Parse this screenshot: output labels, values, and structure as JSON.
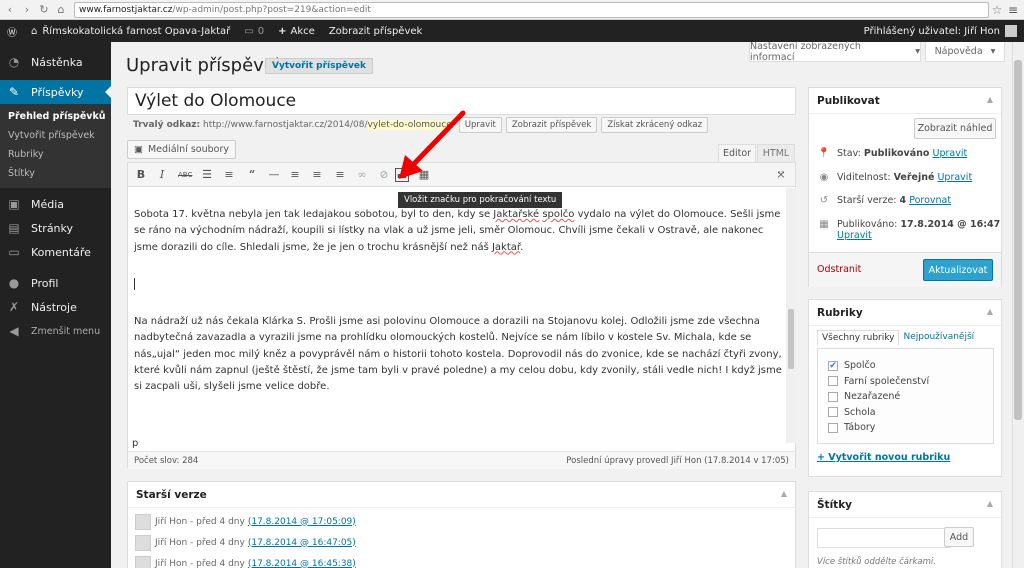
{
  "browser": {
    "url_host": "www.farnostjaktar.cz",
    "url_path": "/wp-admin/post.php?post=219&action=edit"
  },
  "adminbar": {
    "site_name": "Římskokatolická farnost Opava-Jaktař",
    "comments_count": "0",
    "new_label": "Akce",
    "view_post": "Zobrazit příspěvek",
    "user_greeting": "Přihlášený uživatel: Jiří Hon"
  },
  "sidebar": {
    "items": [
      {
        "label": "Nástěnka",
        "icon": "dashboard-icon"
      },
      {
        "label": "Příspěvky",
        "icon": "pin-icon"
      },
      {
        "label": "Média",
        "icon": "media-icon"
      },
      {
        "label": "Stránky",
        "icon": "pages-icon"
      },
      {
        "label": "Komentáře",
        "icon": "comments-icon"
      },
      {
        "label": "Profil",
        "icon": "user-icon"
      },
      {
        "label": "Nástroje",
        "icon": "wrench-icon"
      },
      {
        "label": "Zmenšit menu",
        "icon": "collapse-icon"
      }
    ],
    "submenu": [
      "Přehled příspěvků",
      "Vytvořit příspěvek",
      "Rubriky",
      "Štítky"
    ]
  },
  "header": {
    "screen_options": "Nastavení zobrazených informací",
    "help": "Nápověda",
    "title": "Upravit příspěvek",
    "add_new": "Vytvořit příspěvek"
  },
  "post": {
    "title": "Výlet do Olomouce",
    "permalink_label": "Trvalý odkaz:",
    "permalink_base": "http://www.farnostjaktar.cz/2014/08/",
    "permalink_slug": "vylet-do-olomouce",
    "permalink_tail": "/",
    "btn_edit": "Upravit",
    "btn_view": "Zobrazit příspěvek",
    "btn_shortlink": "Získat zkrácený odkaz"
  },
  "editor": {
    "media_button": "Mediální soubory",
    "tab_visual": "Editor",
    "tab_html": "HTML",
    "tooltip": "Vložit značku pro pokračování textu",
    "path": "p",
    "word_count": "Počet slov: 284",
    "last_edit": "Poslední úpravy provedl Jiří Hon (17.8.2014 v 17:05)",
    "para1": [
      {
        "text": "Sobota 17. května nebyla jen tak ledajakou sobotou, byl to den, kdy se "
      },
      {
        "text": "Jaktařské",
        "spell": true
      },
      {
        "text": " "
      },
      {
        "text": "spolčo",
        "spell": true
      },
      {
        "text": " vydalo na výlet do Olomouce. Sešli jsme se ráno na východním nádraží, koupili si lístky na vlak a už jsme jeli, směr Olomouc. Chvíli jsme čekali v Ostravě, ale nakonec jsme dorazili do cíle. Shledali jsme, že je jen o trochu krásnější než náš "
      },
      {
        "text": "Jaktař",
        "spell": true
      },
      {
        "text": "."
      }
    ],
    "para2": "Na nádraží už nás čekala Klárka S. Prošli jsme asi polovinu Olomouce a dorazili na Stojanovu kolej. Odložili jsme zde všechna nadbytečná zavazadla a vyrazili jsme na prohlídku olomouckých kostelů. Nejvíce se nám líbilo v kostele Sv. Michala, kde se nás„ujal“ jeden moc milý kněz a povyprávěl nám o historii tohoto kostela. Doprovodil nás do zvonice, kde se nachází čtyři zvony, které kvůli nám zapnul (ještě štěstí, že jsme tam byli v pravé poledne) a my celou dobu, kdy zvonily, stáli vedle nich! I když jsme si zacpali uši, slyšeli jsme velice dobře."
  },
  "revisions": {
    "title": "Starší verze",
    "rows": [
      {
        "author": "Jiří Hon - před 4 dny",
        "date": "(17.8.2014 @ 17:05:09)"
      },
      {
        "author": "Jiří Hon - před 4 dny",
        "date": "(17.8.2014 @ 16:47:05)"
      },
      {
        "author": "Jiří Hon - před 4 dny",
        "date": "(17.8.2014 @ 16:45:38)"
      }
    ]
  },
  "publish": {
    "title": "Publikovat",
    "preview": "Zobrazit náhled",
    "status_label": "Stav:",
    "status_value": "Publikováno",
    "visibility_label": "Viditelnost:",
    "visibility_value": "Veřejné",
    "revisions_label": "Starší verze:",
    "revisions_value": "4",
    "revisions_link": "Porovnat",
    "published_label": "Publikováno:",
    "published_value": "17.8.2014 @ 16:47",
    "edit_link": "Upravit",
    "delete": "Odstranit",
    "update": "Aktualizovat"
  },
  "categories": {
    "title": "Rubriky",
    "tab_all": "Všechny rubriky",
    "tab_popular": "Nejpoužívanější",
    "items": [
      {
        "label": "Spolčo",
        "checked": true
      },
      {
        "label": "Farní společenství",
        "checked": false
      },
      {
        "label": "Nezařazené",
        "checked": false
      },
      {
        "label": "Schola",
        "checked": false
      },
      {
        "label": "Tábory",
        "checked": false
      }
    ],
    "add_new": "+ Vytvořit novou rubriku"
  },
  "tags": {
    "title": "Štítky",
    "add": "Add",
    "hint": "Více štítků oddělte čárkami."
  }
}
